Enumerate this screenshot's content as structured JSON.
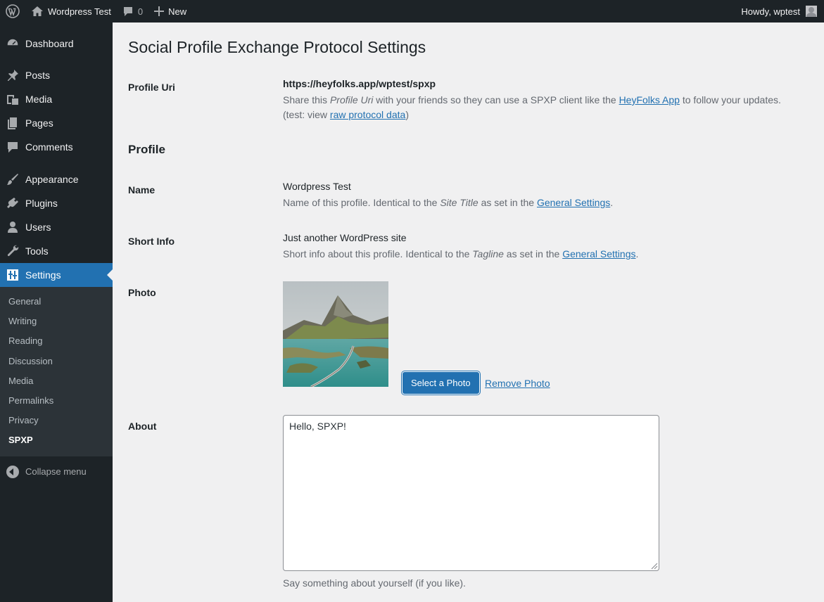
{
  "adminbar": {
    "site_name": "Wordpress Test",
    "comments_count": "0",
    "new_label": "New",
    "howdy": "Howdy, wptest"
  },
  "sidebar": {
    "items": [
      {
        "label": "Dashboard",
        "icon": "dashboard-icon"
      },
      {
        "label": "Posts",
        "icon": "pin-icon"
      },
      {
        "label": "Media",
        "icon": "media-icon"
      },
      {
        "label": "Pages",
        "icon": "pages-icon"
      },
      {
        "label": "Comments",
        "icon": "comment-icon"
      },
      {
        "label": "Appearance",
        "icon": "brush-icon"
      },
      {
        "label": "Plugins",
        "icon": "plugin-icon"
      },
      {
        "label": "Users",
        "icon": "user-icon"
      },
      {
        "label": "Tools",
        "icon": "wrench-icon"
      },
      {
        "label": "Settings",
        "icon": "settings-icon"
      }
    ],
    "submenu": [
      "General",
      "Writing",
      "Reading",
      "Discussion",
      "Media",
      "Permalinks",
      "Privacy",
      "SPXP"
    ],
    "collapse_label": "Collapse menu"
  },
  "page": {
    "title": "Social Profile Exchange Protocol Settings",
    "profile_uri": {
      "label": "Profile Uri",
      "value": "https://heyfolks.app/wptest/spxp",
      "desc_1": "Share this ",
      "desc_em": "Profile Uri",
      "desc_2": " with your friends so they can use a SPXP client like the ",
      "desc_link": "HeyFolks App",
      "desc_3": " to follow your updates.",
      "test_1": "(test: view ",
      "test_link": "raw protocol data",
      "test_2": ")"
    },
    "profile_heading": "Profile",
    "name": {
      "label": "Name",
      "value": "Wordpress Test",
      "desc_1": "Name of this profile. Identical to the ",
      "desc_em": "Site Title",
      "desc_2": " as set in the ",
      "desc_link": "General Settings",
      "desc_3": "."
    },
    "short_info": {
      "label": "Short Info",
      "value": "Just another WordPress site",
      "desc_1": "Short info about this profile. Identical to the ",
      "desc_em": "Tagline",
      "desc_2": " as set in the ",
      "desc_link": "General Settings",
      "desc_3": "."
    },
    "photo": {
      "label": "Photo",
      "select_button": "Select a Photo",
      "remove_link": "Remove Photo"
    },
    "about": {
      "label": "About",
      "value": "Hello, SPXP!",
      "desc": "Say something about yourself (if you like)."
    }
  },
  "colors": {
    "admin_dark": "#1d2327",
    "accent_blue": "#2271b1",
    "page_bg": "#f0f0f1"
  }
}
